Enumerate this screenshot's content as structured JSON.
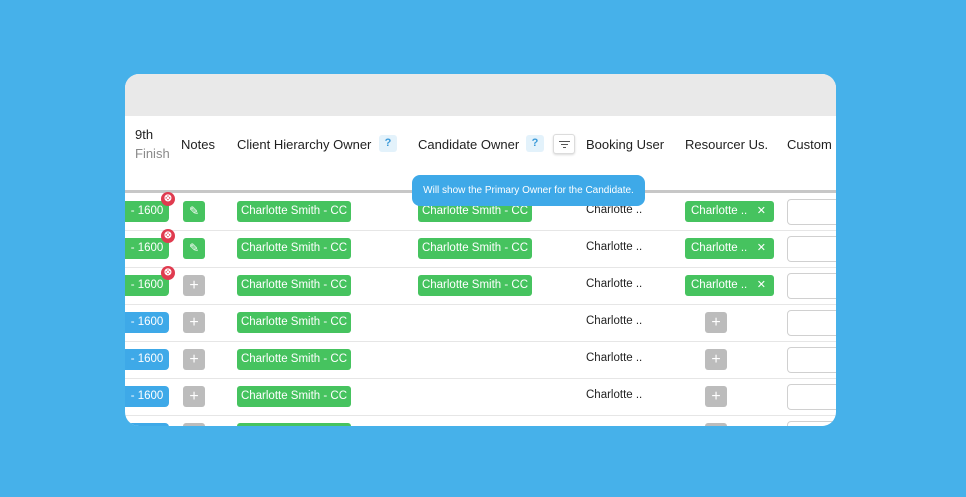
{
  "headers": {
    "col_9th": "9th",
    "col_finish": "Finish",
    "notes": "Notes",
    "client_hierarchy_owner": "Client Hierarchy Owner",
    "candidate_owner": "Candidate Owner",
    "booking_user": "Booking User",
    "resourcer_user": "Resourcer Us.",
    "custom": "Custom",
    "help_badge": "?"
  },
  "tooltip": "Will show the Primary Owner for the Candidate.",
  "rows": [
    {
      "time": "- 1600",
      "time_color": "green",
      "has_remove": true,
      "notes": "edit",
      "hierarchy": "Charlotte Smith - CC",
      "candidate": "Charlotte Smith - CC",
      "booking": "Charlotte ..",
      "resourcer": "Charlotte ..",
      "resourcer_x": "✕"
    },
    {
      "time": "- 1600",
      "time_color": "green",
      "has_remove": true,
      "notes": "edit",
      "hierarchy": "Charlotte Smith - CC",
      "candidate": "Charlotte Smith - CC",
      "booking": "Charlotte ..",
      "resourcer": "Charlotte ..",
      "resourcer_x": "✕"
    },
    {
      "time": "- 1600",
      "time_color": "green",
      "has_remove": true,
      "notes": "add",
      "hierarchy": "Charlotte Smith - CC",
      "candidate": "Charlotte Smith - CC",
      "booking": "Charlotte ..",
      "resourcer": "Charlotte ..",
      "resourcer_x": "✕"
    },
    {
      "time": "- 1600",
      "time_color": "blue",
      "has_remove": false,
      "notes": "add",
      "hierarchy": "Charlotte Smith - CC",
      "candidate": "",
      "booking": "Charlotte ..",
      "resourcer": "",
      "resourcer_x": ""
    },
    {
      "time": "- 1600",
      "time_color": "blue",
      "has_remove": false,
      "notes": "add",
      "hierarchy": "Charlotte Smith - CC",
      "candidate": "",
      "booking": "Charlotte ..",
      "resourcer": "",
      "resourcer_x": ""
    },
    {
      "time": "- 1600",
      "time_color": "blue",
      "has_remove": false,
      "notes": "add",
      "hierarchy": "Charlotte Smith - CC",
      "candidate": "",
      "booking": "Charlotte ..",
      "resourcer": "",
      "resourcer_x": ""
    },
    {
      "time": "",
      "time_color": "blue",
      "has_remove": false,
      "notes": "add",
      "hierarchy": "",
      "candidate": "",
      "booking": "",
      "resourcer": "",
      "resourcer_x": ""
    }
  ],
  "icons": {
    "remove": "remove-circle-icon",
    "edit": "pencil-icon",
    "add": "plus-icon",
    "filter": "filter-icon"
  },
  "colors": {
    "background": "#46b1ea",
    "green": "#46c35f",
    "blue": "#3ea9e8",
    "remove_red": "#e03b4f",
    "grey_button": "#bcbcbc"
  }
}
